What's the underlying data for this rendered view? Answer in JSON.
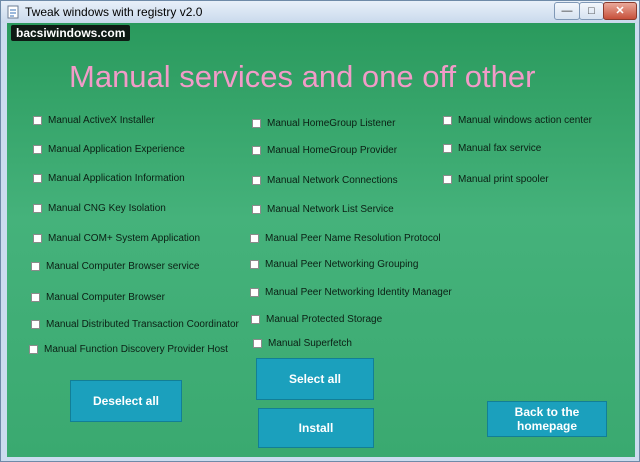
{
  "window": {
    "title": "Tweak windows with registry v2.0",
    "minimize": "—",
    "maximize": "□",
    "close": "✕"
  },
  "badge": "bacsiwindows.com",
  "heading": "Manual services and one off other",
  "columns": [
    [
      "Manual ActiveX Installer",
      "Manual Application Experience",
      "Manual Application Information",
      "Manual CNG Key Isolation",
      "Manual COM+ System Application",
      "Manual Computer Browser service",
      "Manual Computer Browser",
      "Manual Distributed Transaction Coordinator",
      "Manual Function Discovery Provider Host"
    ],
    [
      "Manual HomeGroup Listener",
      "Manual HomeGroup Provider",
      "Manual Network Connections",
      "Manual Network List Service",
      "Manual Peer Name Resolution Protocol",
      "Manual Peer Networking Grouping",
      "Manual Peer Networking Identity Manager",
      "Manual Protected Storage",
      "Manual Superfetch"
    ],
    [
      "Manual windows action center",
      "Manual fax service",
      "Manual print spooler"
    ]
  ],
  "buttons": {
    "deselect": "Deselect all",
    "select": "Select all",
    "install": "Install",
    "back_line1": "Back to the",
    "back_line2": "homepage"
  },
  "colors": {
    "accent_button": "#1ba0bd",
    "heading": "#f29bc8",
    "background": "#2a9a5d"
  }
}
